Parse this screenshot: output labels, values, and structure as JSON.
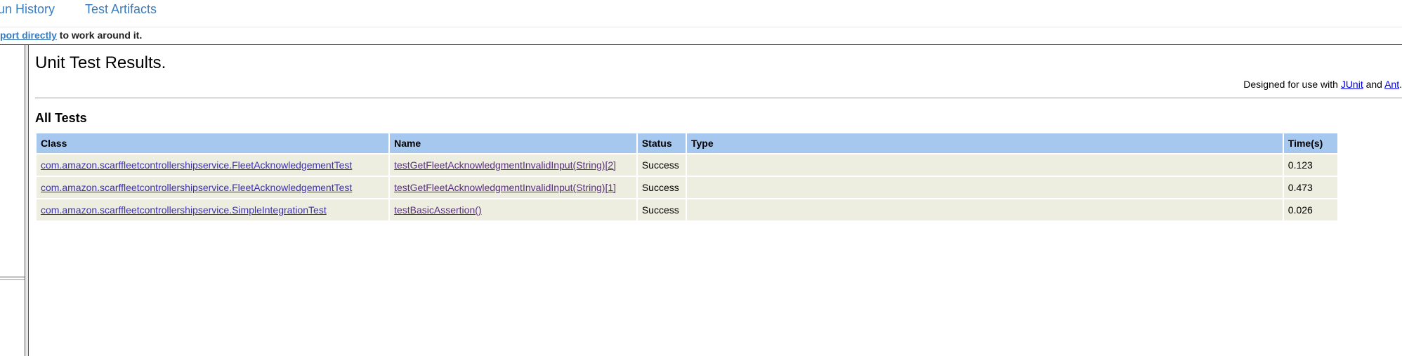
{
  "topnav": {
    "tabs": [
      "un History",
      "Test Artifacts"
    ]
  },
  "notice": {
    "link_text": "port directly",
    "text": " to work around it."
  },
  "report": {
    "title": "Unit Test Results.",
    "designed_prefix": "Designed for use with ",
    "junit_link": "JUnit",
    "and_text": " and ",
    "ant_link": "Ant",
    "period": ".",
    "section_title": "All Tests",
    "columns": [
      "Class",
      "Name",
      "Status",
      "Type",
      "Time(s)"
    ],
    "rows": [
      {
        "class": "com.amazon.scarffleetcontrollershipservice.FleetAcknowledgementTest",
        "name": "testGetFleetAcknowledgmentInvalidInput(String)[2]",
        "status": "Success",
        "type": "",
        "time": "0.123"
      },
      {
        "class": "com.amazon.scarffleetcontrollershipservice.FleetAcknowledgementTest",
        "name": "testGetFleetAcknowledgmentInvalidInput(String)[1]",
        "status": "Success",
        "type": "",
        "time": "0.473"
      },
      {
        "class": "com.amazon.scarffleetcontrollershipservice.SimpleIntegrationTest",
        "name": "testBasicAssertion()",
        "status": "Success",
        "type": "",
        "time": "0.026"
      }
    ]
  }
}
